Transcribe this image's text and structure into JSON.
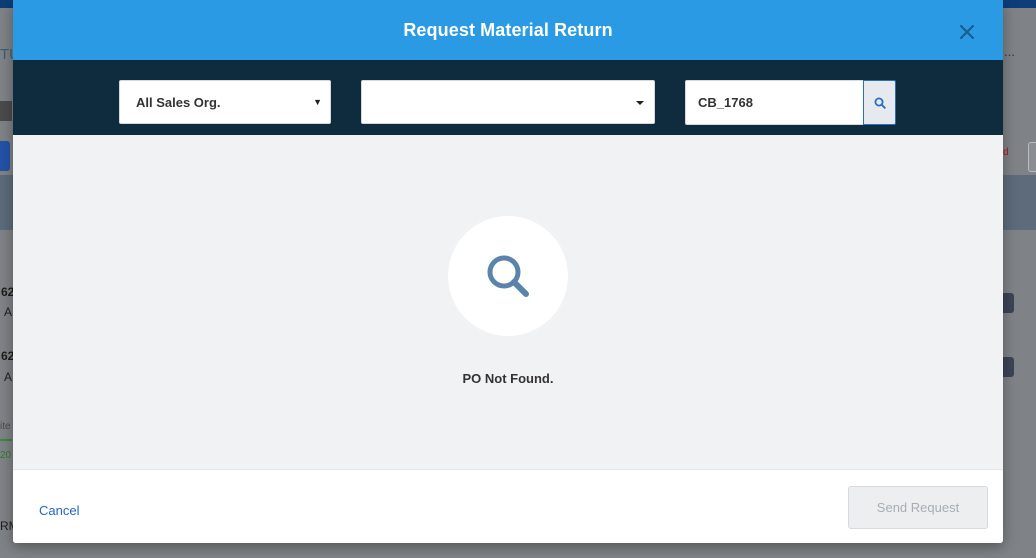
{
  "background": {
    "side_fragments": [
      "TU",
      "62",
      "A",
      "62",
      "A",
      "ite",
      "20",
      "RM"
    ],
    "right_fragment": "d",
    "dots": "..."
  },
  "modal": {
    "title": "Request Material Return",
    "close_icon": "close-icon",
    "filters": {
      "sales_org_value": "All Sales Org.",
      "second_select_value": "",
      "search_value": "CB_1768",
      "search_icon": "search-icon"
    },
    "empty_state": {
      "icon": "magnifier-icon",
      "message": "PO Not Found."
    },
    "footer": {
      "cancel_label": "Cancel",
      "send_label": "Send Request"
    }
  },
  "colors": {
    "header": "#2b9ae4",
    "filter_bar": "#0f2c3f",
    "icon": "#5b84ad",
    "link": "#1f66c7"
  }
}
